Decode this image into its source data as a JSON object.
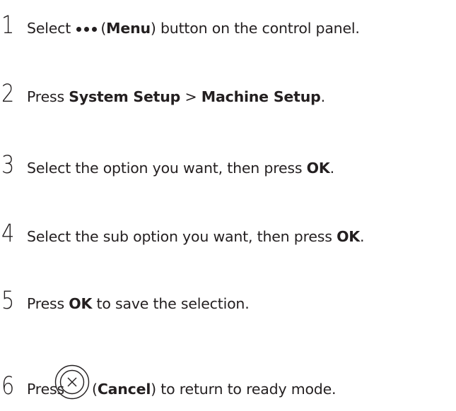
{
  "steps": [
    {
      "number": "1",
      "pre": "Select ",
      "icon": "menu-dots-icon",
      "mid": "(",
      "bold": "Menu",
      "post": ") button on the control panel."
    },
    {
      "number": "2",
      "pre": "Press ",
      "bold1": "System Setup",
      "sep": " > ",
      "bold2": "Machine Setup",
      "post": "."
    },
    {
      "number": "3",
      "pre": "Select the option you want, then press ",
      "bold": "OK",
      "post": "."
    },
    {
      "number": "4",
      "pre": "Select the sub option you want, then press ",
      "bold": "OK",
      "post": "."
    },
    {
      "number": "5",
      "pre": "Press ",
      "bold": "OK",
      "post": " to save the selection."
    },
    {
      "number": "6",
      "pre": "Press",
      "icon": "cancel-icon",
      "mid": "(",
      "bold": "Cancel",
      "post": ") to return to ready mode."
    }
  ]
}
